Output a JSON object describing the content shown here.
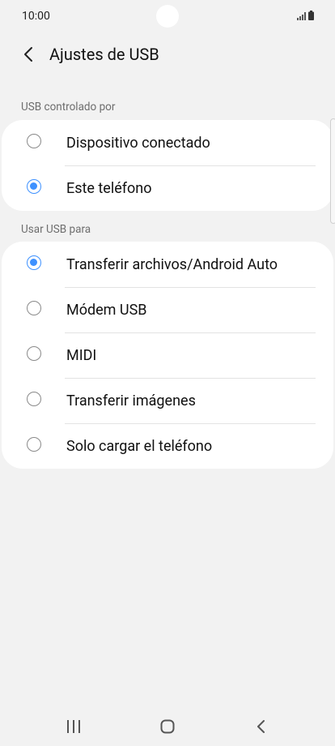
{
  "status_bar": {
    "time": "10:00",
    "icons": [
      "signal-icon",
      "battery-icon"
    ]
  },
  "header": {
    "back_icon": "back-arrow-icon",
    "title": "Ajustes de USB"
  },
  "section_controlled": {
    "label": "USB controlado por",
    "options": [
      {
        "label": "Dispositivo conectado",
        "selected": false
      },
      {
        "label": "Este teléfono",
        "selected": true
      }
    ]
  },
  "section_use": {
    "label": "Usar USB para",
    "options": [
      {
        "label": "Transferir archivos/Android Auto",
        "selected": true
      },
      {
        "label": "Módem USB",
        "selected": false
      },
      {
        "label": "MIDI",
        "selected": false
      },
      {
        "label": "Transferir imágenes",
        "selected": false
      },
      {
        "label": "Solo cargar el teléfono",
        "selected": false
      }
    ]
  },
  "nav_bar": {
    "buttons": [
      "recent-apps-icon",
      "home-icon",
      "back-icon"
    ]
  },
  "colors": {
    "accent": "#3e91ff",
    "background": "#f2f2f2",
    "card": "#ffffff"
  }
}
